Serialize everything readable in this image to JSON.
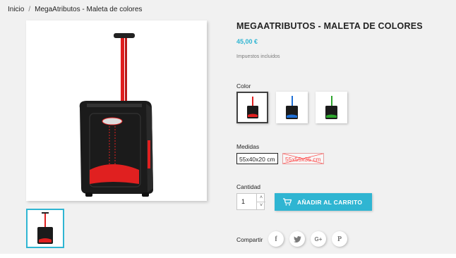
{
  "breadcrumb": {
    "items": [
      "Inicio",
      "MegaAtributos - Maleta de colores"
    ],
    "separator": "/"
  },
  "product": {
    "title": "MEGAATRIBUTOS - MALETA DE COLORES",
    "price": "45,00 €",
    "tax_note": "Impuestos incluidos"
  },
  "color": {
    "label": "Color",
    "options": [
      {
        "name": "rojo",
        "accent": "#e02020",
        "selected": true
      },
      {
        "name": "azul",
        "accent": "#1e6fd6",
        "selected": false
      },
      {
        "name": "verde",
        "accent": "#2ea62e",
        "selected": false
      }
    ]
  },
  "sizes": {
    "label": "Medidas",
    "options": [
      {
        "label": "55x40x20 cm",
        "selected": true,
        "available": true
      },
      {
        "label": "55x55x35 cm",
        "selected": false,
        "available": false
      }
    ]
  },
  "quantity": {
    "label": "Cantidad",
    "value": "1",
    "up": "˄",
    "down": "˅"
  },
  "cart": {
    "button_label": "AÑADIR AL CARRITO"
  },
  "share": {
    "label": "Compartir",
    "networks": [
      {
        "name": "facebook",
        "glyph": "f"
      },
      {
        "name": "twitter",
        "glyph": "t"
      },
      {
        "name": "google-plus",
        "glyph": "G+"
      },
      {
        "name": "pinterest",
        "glyph": "P"
      }
    ]
  },
  "colors": {
    "accent": "#2fb5d2",
    "bag_body": "#1a1a1a",
    "bag_red": "#e02020",
    "page_bg": "#f1f1f1"
  }
}
